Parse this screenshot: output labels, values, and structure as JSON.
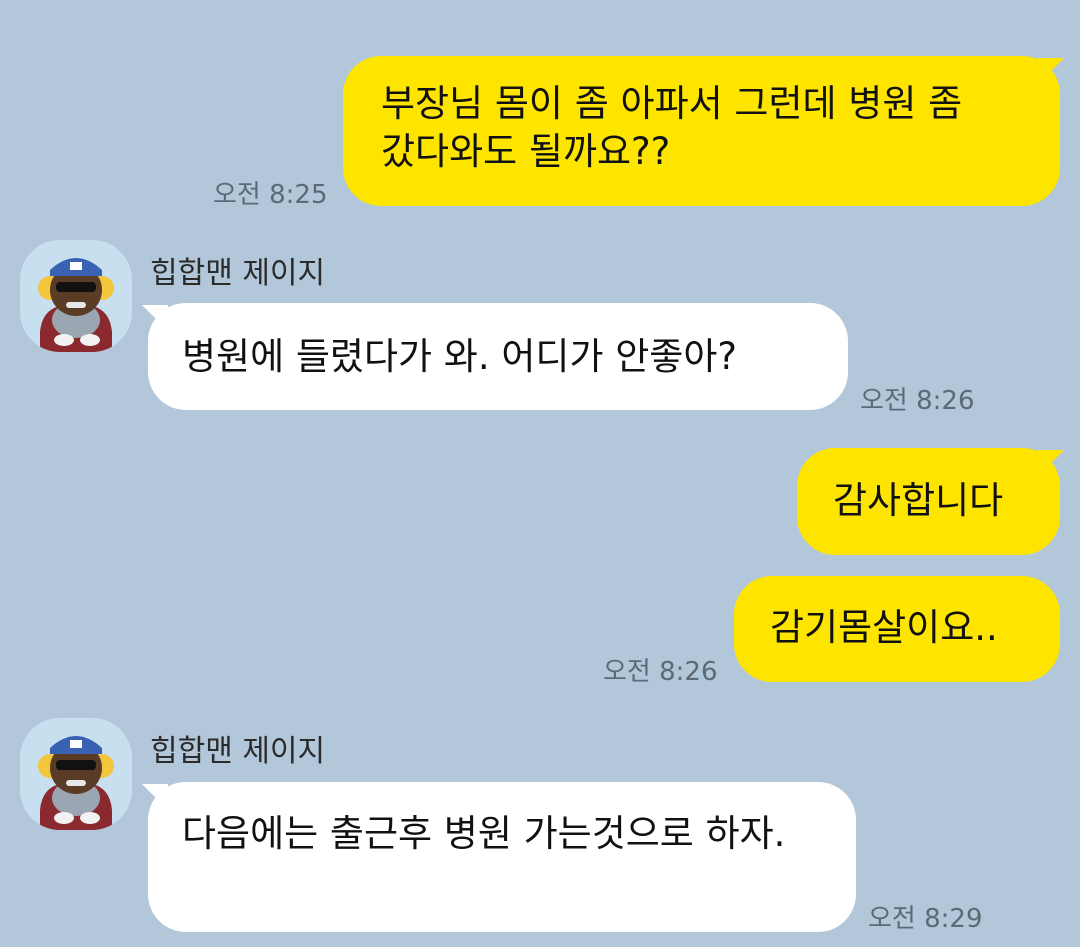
{
  "chat": {
    "messages": [
      {
        "sender": "me",
        "text": "부장님 몸이 좀 아파서 그런데 병원 좀 갔다와도 될까요??",
        "time": "오전 8:25"
      },
      {
        "sender": "other",
        "name": "힙합맨 제이지",
        "text": "병원에 들렸다가 와. 어디가 안좋아?",
        "time": "오전 8:26"
      },
      {
        "sender": "me",
        "text": "감사합니다",
        "time": ""
      },
      {
        "sender": "me",
        "text": "감기몸살이요..",
        "time": "오전 8:26"
      },
      {
        "sender": "other",
        "name": "힙합맨 제이지",
        "text": "다음에는 출근후 병원 가는것으로 하자.",
        "time": "오전 8:29"
      }
    ]
  },
  "colors": {
    "background": "#b2c7d9",
    "my_bubble": "#fee500",
    "other_bubble": "#ffffff",
    "timestamp": "#5d6a76"
  },
  "icons": {
    "avatar": "hiphop-character-avatar-icon"
  }
}
